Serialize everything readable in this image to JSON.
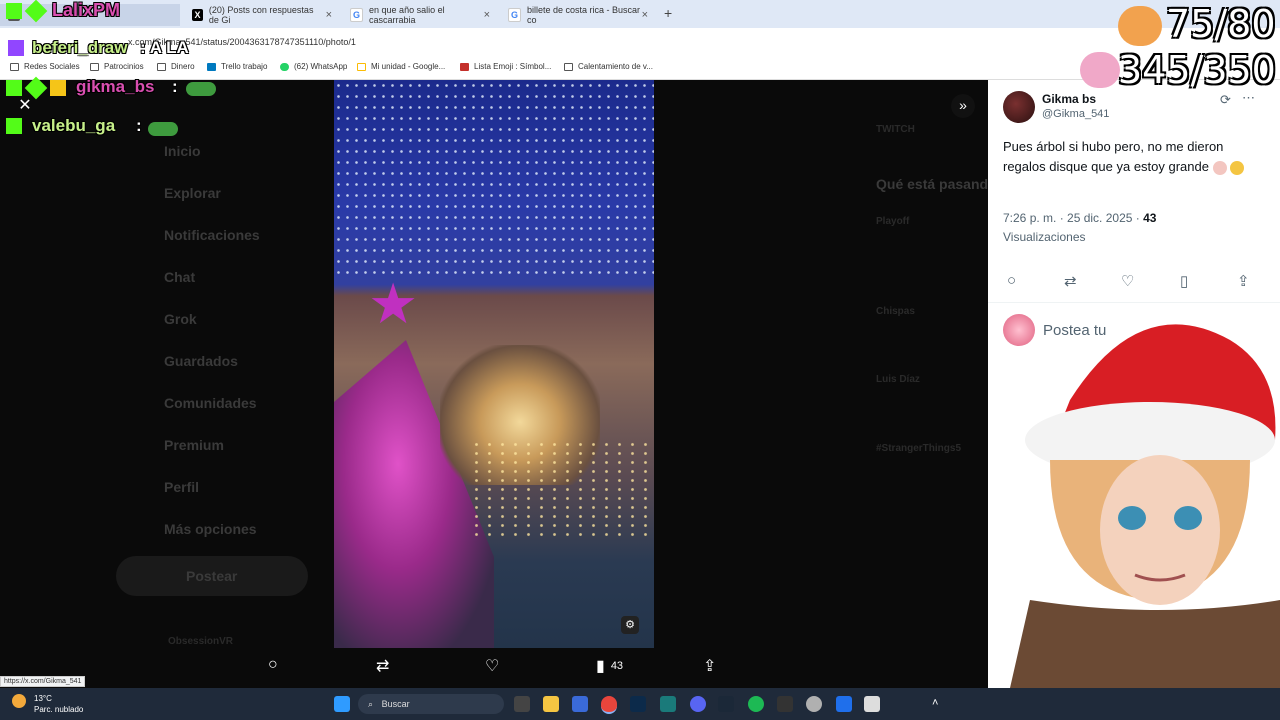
{
  "browser": {
    "tabs": [
      {
        "label": "LalixPM",
        "close": "×"
      },
      {
        "label": "(20) Posts con respuestas de Gi",
        "close": "×"
      },
      {
        "label": "en que año salio el cascarrabia",
        "close": "×"
      },
      {
        "label": "billete de costa rica - Buscar co",
        "close": "×"
      }
    ],
    "add_tab": "+",
    "url": "x.com/Gikma_541/status/2004363178747351110/photo/1",
    "bookmarks": [
      "Redes Sociales",
      "Patrocinios",
      "Dinero",
      "Trello trabajo",
      "(62) WhatsApp",
      "Mi unidad - Google...",
      "Lista Emoji : Símbol...",
      "Calentamiento de v..."
    ]
  },
  "chat": [
    {
      "user": "beferi_draw",
      "message": ": A LA"
    },
    {
      "user": "gikma_bs",
      "message": ":"
    },
    {
      "user": "valebu_ga",
      "message": ":"
    }
  ],
  "counters": {
    "first": "75/80",
    "second": "345/350"
  },
  "background_page": {
    "nav": [
      "Inicio",
      "Explorar",
      "Notificaciones",
      "Chat",
      "Grok",
      "Guardados",
      "Comunidades",
      "Premium",
      "Perfil",
      "Más opciones"
    ],
    "post_button": "Postear",
    "right": {
      "heading": "Qué está pasando",
      "trends": [
        "Playoff",
        "Chispas",
        "Luis Díaz",
        "#StrangerThings5"
      ],
      "twitch": "TWITCH"
    },
    "footer_user": "ObsessionVR"
  },
  "viewer": {
    "close": "✕",
    "next": "»",
    "actions": {
      "reply": "○",
      "repost": "⇄",
      "like": "♡",
      "views_icon": "▮",
      "views": "43",
      "share": "⇪"
    }
  },
  "tweet": {
    "name": "Gikma bs",
    "handle": "@Gikma_541",
    "text": "Pues árbol si hubo pero, no me dieron regalos disque que ya estoy grande",
    "time": "7:26 p. m. · 25 dic. 2025 · ",
    "views_count": "43",
    "views_label": "Visualizaciones",
    "reply_placeholder": "Postea tu"
  },
  "status_url": "https://x.com/Gikma_541",
  "taskbar": {
    "temp": "13°C",
    "weather": "Parc. nublado",
    "search": "Buscar"
  }
}
